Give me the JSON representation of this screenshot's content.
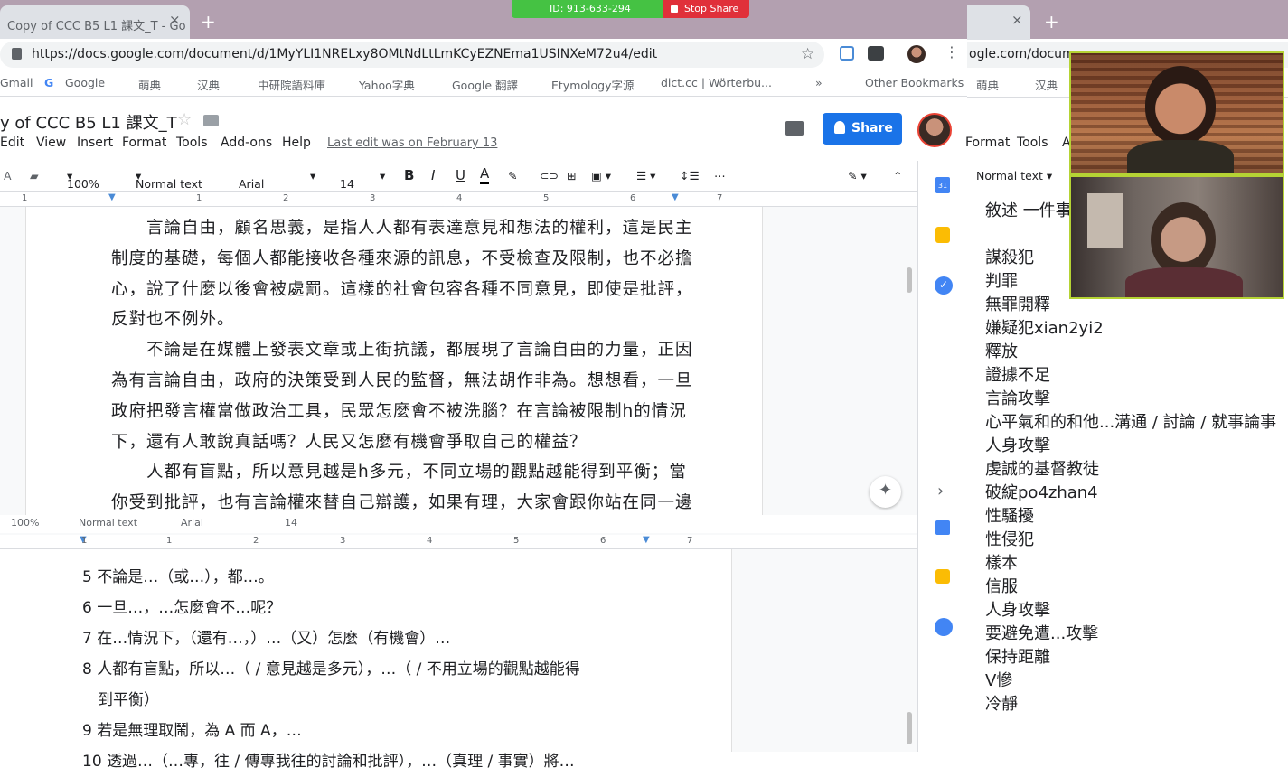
{
  "browser_left": {
    "tab_title": "Copy of CCC B5 L1 課文_T - Go",
    "url": "https://docs.google.com/document/d/1MyYLI1NRELxy8OMtNdLtLmKCyEZNEma1USINXeM72u4/edit",
    "bookmarks": [
      "Gmail",
      "Google",
      "萌典",
      "汉典",
      "中研院語料庫",
      "Yahoo字典",
      "Google 翻譯",
      "Etymology字源",
      "dict.cc | Wörterbu...",
      "»",
      "Other Bookmarks"
    ]
  },
  "zoom": {
    "id_label": "ID: 913-633-294",
    "stop_label": "Stop Share"
  },
  "docs": {
    "title": "y of CCC B5 L1 課文_T",
    "menu": [
      "Edit",
      "View",
      "Insert",
      "Format",
      "Tools",
      "Add-ons",
      "Help"
    ],
    "last_edit": "Last edit was on February 13",
    "share_label": "Share",
    "toolbar": {
      "zoom": "100%",
      "style": "Normal text",
      "font": "Arial",
      "size": "14",
      "bold": "B",
      "italic": "I",
      "underline": "U",
      "text_color": "A"
    },
    "ruler_numbers": [
      "1",
      "1",
      "2",
      "3",
      "4",
      "5",
      "6",
      "7"
    ],
    "paragraphs": [
      "　　言論自由，顧名思義，是指人人都有表達意見和想法的權利，這是民主",
      "制度的基礎，每個人都能接收各種來源的訊息，不受檢查及限制，也不必擔",
      "心，說了什麼以後會被處罰。這樣的社會包容各種不同意見，即使是批評，",
      "反對也不例外。",
      "　　不論是在媒體上發表文章或上街抗議，都展現了言論自由的力量，正因",
      "為有言論自由，政府的決策受到人民的監督，無法胡作非為。想想看，一旦",
      "政府把發言權當做政治工具，民眾怎麼會不被洗腦？在言論被限制h的情況",
      "下，還有人敢說真話嗎？人民又怎麼有機會爭取自己的權益？",
      "　　人都有盲點，所以意見越是h多元，不同立場的觀點越能得到平衡；當",
      "你受到批評，也有言論權來替自己辯護，如果有理，大家會跟你站在同一邊"
    ]
  },
  "bottom_doc": {
    "toolbar": {
      "zoom": "100%",
      "style": "Normal text",
      "font": "Arial",
      "size": "14"
    },
    "ruler_numbers": [
      "1",
      "1",
      "2",
      "3",
      "4",
      "5",
      "6",
      "7"
    ],
    "lines": [
      "5 不論是…（或…），都…。",
      "6 一旦…，…怎麼會不…呢？",
      "7 在…情況下，（還有…，）…（又）怎麼（有機會）…",
      "8 人都有盲點，所以…（ / 意見越是多元），…（ / 不用立場的觀點越能得",
      "　到平衡）",
      "9 若是無理取鬧，為 A 而 A，…",
      "10 透過…（…專，往 / 傳專我往的討論和批評），…（真理 / 事實）將…"
    ]
  },
  "browser_right": {
    "tab_close": "×",
    "url_fragment": "ogle.com/docume",
    "bookmarks": [
      "萌典",
      "汉典"
    ],
    "menu": [
      "Format",
      "Tools",
      "A"
    ],
    "style": "Normal text",
    "words": [
      "敘述 一件事",
      "",
      "謀殺犯",
      "判罪",
      "無罪開釋",
      "嫌疑犯xian2yi2",
      "釋放",
      "證據不足",
      "言論攻擊",
      "心平氣和的和他...溝通 / 討論 / 就事論事",
      "人身攻擊",
      "虔誠的基督教徒",
      "破綻po4zhan4",
      "性騷擾",
      "性侵犯",
      "樣本",
      "信服",
      "人身攻擊",
      "要避免遭...攻擊",
      "保持距離",
      "V慘",
      "冷靜"
    ]
  }
}
